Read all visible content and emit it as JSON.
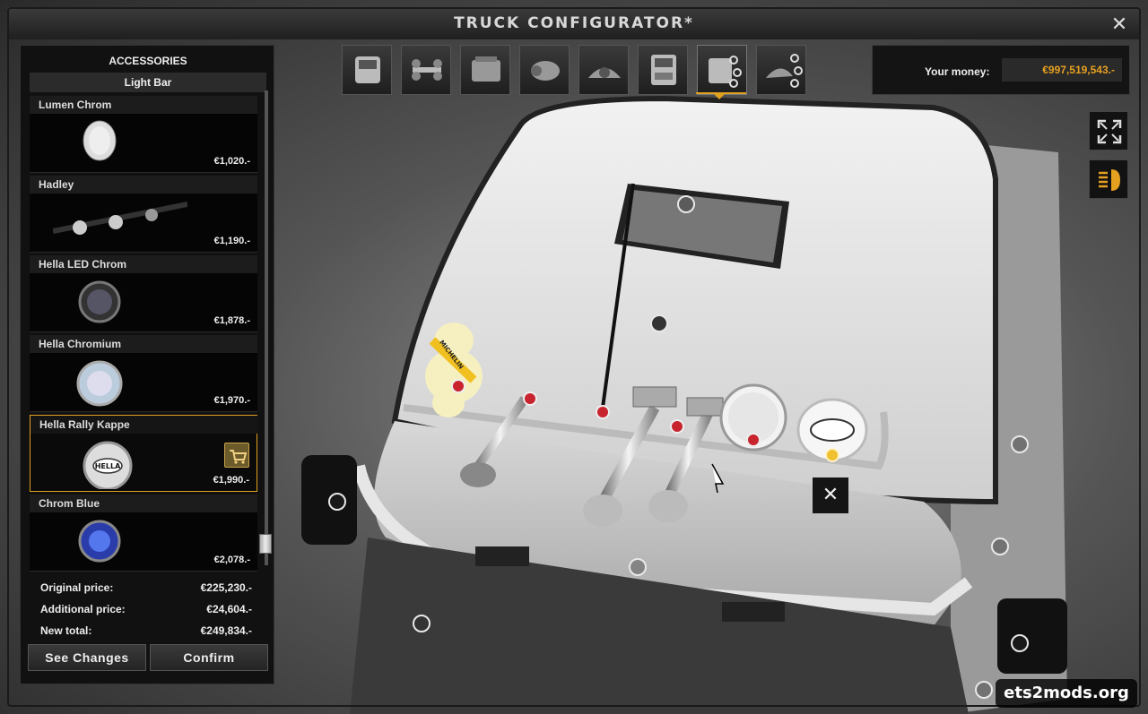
{
  "window": {
    "title": "TRUCK CONFIGURATOR*"
  },
  "tabs": [
    {
      "icon": "cabin-icon"
    },
    {
      "icon": "chassis-icon"
    },
    {
      "icon": "engine-icon"
    },
    {
      "icon": "transmission-icon"
    },
    {
      "icon": "interior-icon"
    },
    {
      "icon": "truck-front-icon"
    },
    {
      "icon": "exterior-accessories-icon",
      "active": true
    },
    {
      "icon": "interior-accessories-icon"
    }
  ],
  "money": {
    "label": "Your money:",
    "value": "€997,519,543.-"
  },
  "panel": {
    "heading": "ACCESSORIES",
    "category": "Light Bar",
    "items": [
      {
        "name": "Lumen Chrom",
        "price": "€1,020.-"
      },
      {
        "name": "Hadley",
        "price": "€1,190.-"
      },
      {
        "name": "Hella LED Chrom",
        "price": "€1,878.-"
      },
      {
        "name": "Hella Chromium",
        "price": "€1,970.-"
      },
      {
        "name": "Hella Rally Kappe",
        "price": "€1,990.-",
        "selected": true
      },
      {
        "name": "Chrom Blue",
        "price": "€2,078.-"
      }
    ],
    "prices": {
      "original_label": "Original price:",
      "original_value": "€225,230.-",
      "additional_label": "Additional price:",
      "additional_value": "€24,604.-",
      "total_label": "New total:",
      "total_value": "€249,834.-"
    },
    "buttons": {
      "see_changes": "See Changes",
      "confirm": "Confirm"
    }
  },
  "badge_text": "HELLA",
  "mascot_text": "MICHELIN",
  "watermark": "ets2mods.org",
  "colors": {
    "accent": "#e0a020",
    "money": "#e6a020",
    "hotspot_red": "#c8242e",
    "hotspot_yellow": "#f0c030"
  }
}
